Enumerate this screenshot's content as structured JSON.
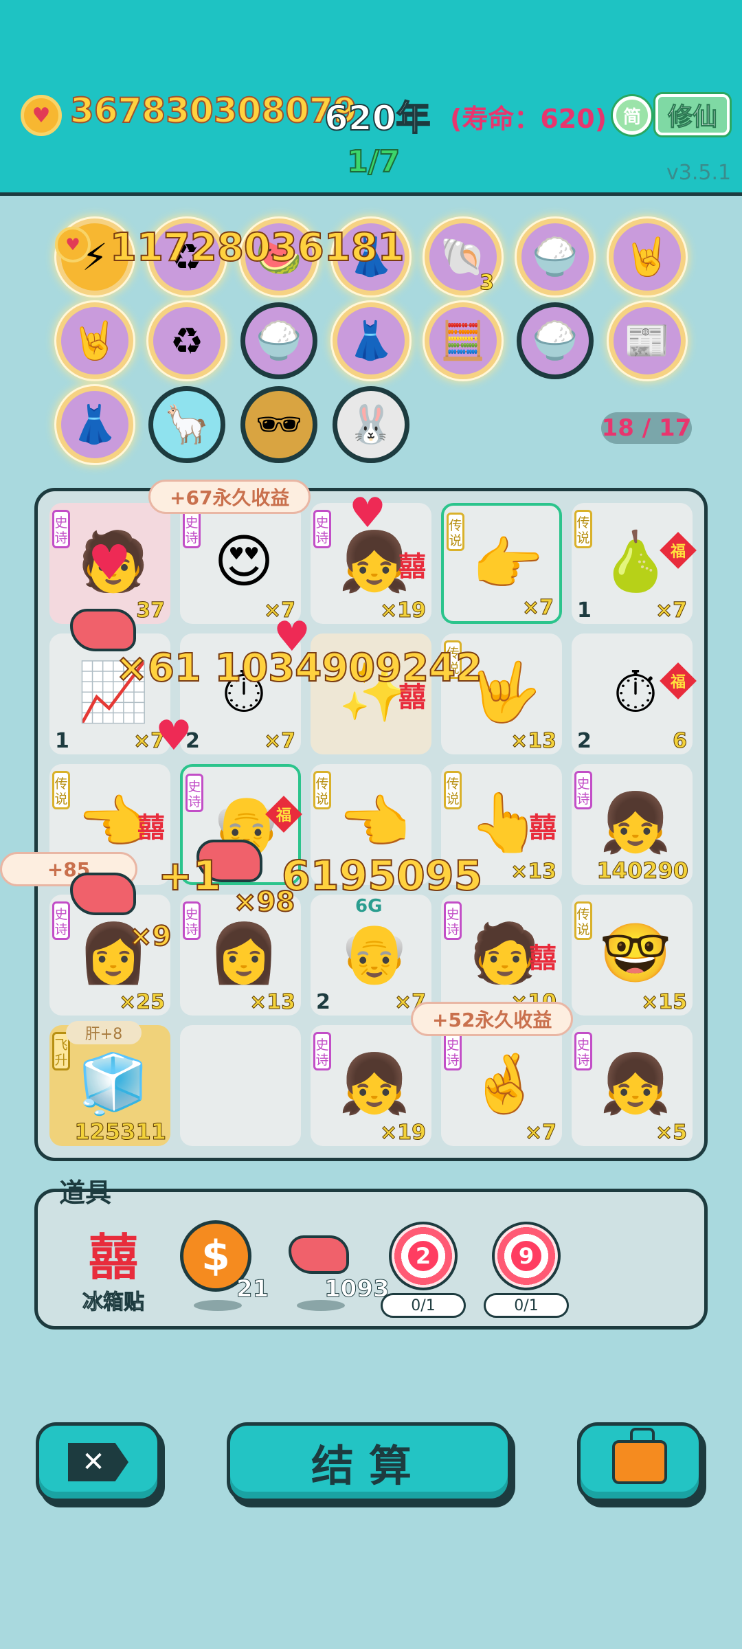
{
  "header": {
    "coins": "367830308079",
    "years": "620年",
    "lifespan": "(寿命：620)",
    "simp_label": "简",
    "xiuxian_label": "修仙",
    "progress": "1/7",
    "version": "v3.5.1"
  },
  "collection": {
    "floating_coins": "11728036181",
    "slots": "18 / 17",
    "shell_count": "3",
    "badges": [
      "lightning-coin",
      "recycle",
      "watermelon",
      "skirt",
      "shell",
      "rice-bowls",
      "rock-hand",
      "rock-hand",
      "recycle",
      "rice-bowls",
      "skirt",
      "math-face",
      "rice-bowls",
      "time-magazine",
      "skirt",
      "alpaca",
      "durian-sunglasses",
      "rabbit"
    ]
  },
  "board": {
    "tags": {
      "epic": "史诗",
      "legend": "传说",
      "fly": "飞升"
    },
    "fu": "福",
    "xi": "囍",
    "gan_tag": "肝+8",
    "cells": {
      "r1c1_mult": "37",
      "r1c2_mult": "×7",
      "r1c3_mult": "×19",
      "r1c4_mult": "×7",
      "r1c5_lvl": "1",
      "r1c5_mult": "×7",
      "r2c1_lvl": "1",
      "r2c1_mult": "×7",
      "r2c2_lvl": "2",
      "r2c2_mult": "×7",
      "r2c4_mult": "×13",
      "r2c5_lvl": "2",
      "r2c5_mult": "6",
      "r3c4_mult": "×13",
      "r3c5_num": "140290",
      "r4c1_mult": "×25",
      "r4c2_mult": "×13",
      "r4c3_lvl": "2",
      "r4c3_mult": "×7",
      "r4c4_mult": "×10",
      "r4c5_mult": "×15",
      "r5c1_num": "125311",
      "r5c3_mult": "×19",
      "r5c4_mult": "×7",
      "r5c5_mult": "×5"
    },
    "effects": {
      "bubble_top": "+67永久收益",
      "bubble_mid": "+85",
      "bubble_bottom": "+52永久收益",
      "float_big": "×61  1034909242",
      "float_mid": "6195095",
      "float_mid_prefix": "+1",
      "float_x98": "×98",
      "float_x9": "×9",
      "sixg": "6G"
    }
  },
  "props": {
    "title": "道具",
    "fridge_char": "囍",
    "fridge_label": "冰箱贴",
    "coin_symbol": "$",
    "coin_count": "21",
    "liver_count": "1093",
    "target1_num": "2",
    "target1_progress": "0/1",
    "target2_num": "9",
    "target2_progress": "0/1"
  },
  "buttons": {
    "close_symbol": "✕",
    "settle_label": "结算"
  }
}
